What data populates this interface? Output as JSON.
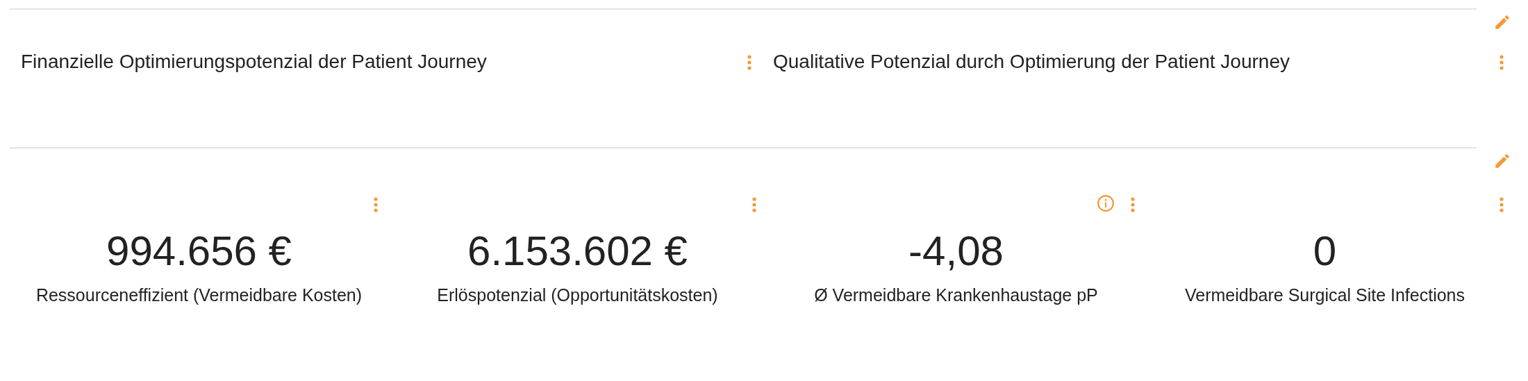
{
  "sections": [
    {
      "kind": "titles",
      "editable": true,
      "panels": [
        {
          "title": "Finanzielle Optimierungspotenzial der Patient Journey"
        },
        {
          "title": "Qualitative Potenzial durch Optimierung der Patient Journey"
        }
      ]
    },
    {
      "kind": "kpis",
      "editable": true,
      "tiles": [
        {
          "value": "994.656 €",
          "label": "Ressourceneffizient (Vermeidbare Kosten)",
          "info": false
        },
        {
          "value": "6.153.602 €",
          "label": "Erlöspotenzial (Opportunitätskosten)",
          "info": false
        },
        {
          "value": "-4,08",
          "label": "Ø Vermeidbare Krankenhaustage pP",
          "info": true
        },
        {
          "value": "0",
          "label": "Vermeidbare Surgical Site Infections",
          "info": false
        }
      ]
    }
  ]
}
